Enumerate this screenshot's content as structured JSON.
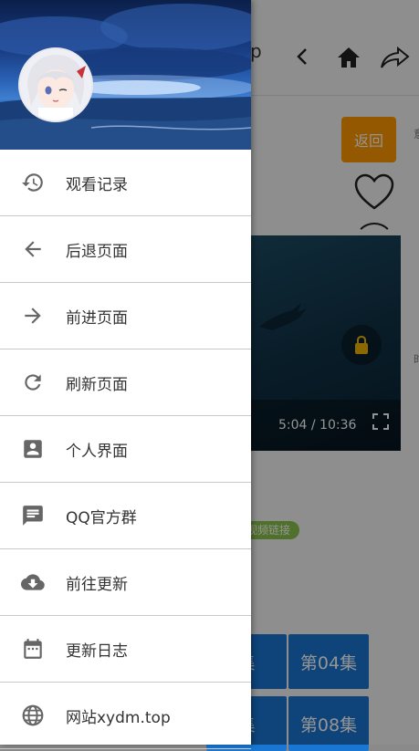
{
  "background": {
    "title_fragment": "p",
    "back_button_label": "返回",
    "video_time": "5:04 / 10:36",
    "link_badge": "视频链接",
    "episodes": [
      "集",
      "第04集",
      "集",
      "第08集"
    ],
    "edge_marks": [
      "意",
      "时"
    ]
  },
  "drawer": {
    "menu_items": [
      {
        "label": "观看记录",
        "icon": "history-icon"
      },
      {
        "label": "后退页面",
        "icon": "arrow-back-icon"
      },
      {
        "label": "前进页面",
        "icon": "arrow-forward-icon"
      },
      {
        "label": "刷新页面",
        "icon": "refresh-icon"
      },
      {
        "label": "个人界面",
        "icon": "account-box-icon"
      },
      {
        "label": "QQ官方群",
        "icon": "chat-icon"
      },
      {
        "label": "前往更新",
        "icon": "cloud-download-icon"
      },
      {
        "label": "更新日志",
        "icon": "calendar-icon"
      },
      {
        "label": "网站xydm.top",
        "icon": "globe-icon"
      }
    ]
  },
  "colors": {
    "accent_orange": "#ff9800",
    "episode_blue": "#1976d2",
    "badge_green": "#8bc34a",
    "icon_gray": "#666666"
  }
}
